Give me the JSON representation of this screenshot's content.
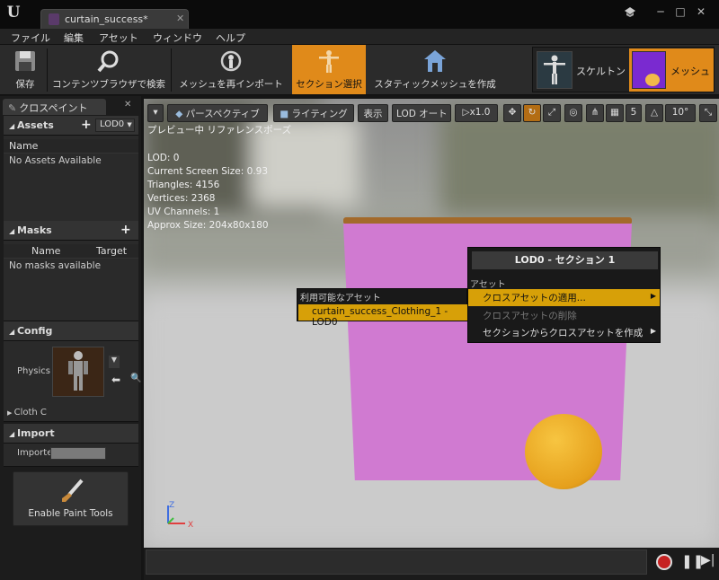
{
  "window": {
    "tab_title": "curtain_success*",
    "logo": "U",
    "buttons": {
      "minimize": "─",
      "maximize": "□",
      "close": "✕"
    },
    "icon_name": "ue4-logo-icon"
  },
  "menu": [
    "ファイル",
    "編集",
    "アセット",
    "ウィンドウ",
    "ヘルプ"
  ],
  "toolbar": {
    "save": "保存",
    "content_browser": "コンテンツブラウザで検索",
    "reimport": "メッシュを再インポート",
    "section_select": "セクション選択",
    "static_mesh": "スタティックメッシュを作成",
    "skeleton": "スケルトン",
    "mesh": "メッシュ"
  },
  "left_panel": {
    "tab": "クロスペイント",
    "assets": {
      "title": "Assets",
      "lod": "LOD0",
      "col_name": "Name",
      "empty": "No Assets Available"
    },
    "masks": {
      "title": "Masks",
      "col_name": "Name",
      "col_target": "Target",
      "empty": "No masks available"
    },
    "config": {
      "title": "Config",
      "physics_label": "Physics",
      "cloth_label": "Cloth C"
    },
    "import": {
      "title": "Import",
      "label": "Importe"
    },
    "paint_tools": "Enable Paint Tools"
  },
  "viewport": {
    "toolbar": {
      "perspective": "パースペクティブ",
      "lighting": "ライティング",
      "show": "表示",
      "lod": "LOD オート",
      "speed": "x1.0",
      "grid_size": "5",
      "angle": "10°"
    },
    "preview_label": "プレビュー中 リファレンスポーズ",
    "stats": [
      "LOD: 0",
      "Current Screen Size: 0.93",
      "Triangles: 4156",
      "Vertices: 2368",
      "UV Channels: 1",
      "Approx Size: 204x80x180"
    ],
    "axis": {
      "x": "X",
      "z": "Z"
    }
  },
  "context_menu": {
    "title": "LOD0 - セクション 1",
    "section_label": "アセット",
    "items": [
      {
        "label": "クロスアセットの適用...",
        "arrow": "▶"
      },
      {
        "label": "クロスアセットの削除"
      },
      {
        "label": "セクションからクロスアセットを作成",
        "arrow": "▶"
      }
    ]
  },
  "submenu": {
    "header": "利用可能なアセット",
    "item": "curtain_success_Clothing_1 - LOD0"
  },
  "colors": {
    "accent": "#e08a1a",
    "highlight": "#d7a008",
    "curtain": "#d07ad1",
    "ball": "#e6a01c"
  }
}
